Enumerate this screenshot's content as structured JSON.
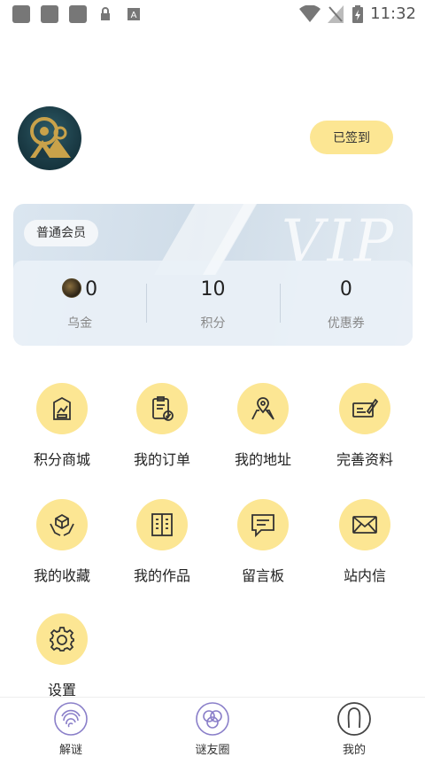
{
  "status_bar": {
    "time": "11:32"
  },
  "profile": {
    "checkin_label": "已签到"
  },
  "vip_card": {
    "member_level": "普通会员",
    "watermark": "VIP",
    "stats": [
      {
        "value": "0",
        "label": "乌金"
      },
      {
        "value": "10",
        "label": "积分"
      },
      {
        "value": "0",
        "label": "优惠券"
      }
    ]
  },
  "menu": [
    {
      "label": "积分商城",
      "icon": "points-mall-icon"
    },
    {
      "label": "我的订单",
      "icon": "orders-icon"
    },
    {
      "label": "我的地址",
      "icon": "address-icon"
    },
    {
      "label": "完善资料",
      "icon": "profile-edit-icon"
    },
    {
      "label": "我的收藏",
      "icon": "favorites-icon"
    },
    {
      "label": "我的作品",
      "icon": "works-icon"
    },
    {
      "label": "留言板",
      "icon": "message-board-icon"
    },
    {
      "label": "站内信",
      "icon": "mail-icon"
    },
    {
      "label": "设置",
      "icon": "gear-icon"
    }
  ],
  "bottom_nav": [
    {
      "label": "解谜",
      "icon": "fingerprint-icon"
    },
    {
      "label": "谜友圈",
      "icon": "circles-icon"
    },
    {
      "label": "我的",
      "icon": "user-icon"
    }
  ],
  "colors": {
    "accent": "#fce693",
    "icon_stroke": "#333333"
  }
}
